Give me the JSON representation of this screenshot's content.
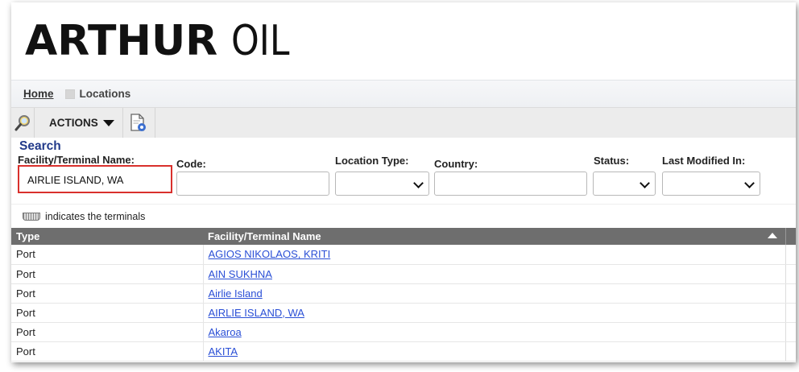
{
  "brand": {
    "name_bold": "ARTHUR",
    "name_thin": "OIL"
  },
  "breadcrumb": {
    "home": "Home",
    "current": "Locations"
  },
  "toolbar": {
    "actions_label": "ACTIONS"
  },
  "search": {
    "title": "Search",
    "facility_label": "Facility/Terminal Name:",
    "facility_value": "AIRLIE ISLAND, WA",
    "code_label": "Code:",
    "code_value": "",
    "location_type_label": "Location Type:",
    "location_type_value": "",
    "country_label": "Country:",
    "country_value": "",
    "status_label": "Status:",
    "status_value": "",
    "last_modified_label": "Last Modified In:",
    "last_modified_value": ""
  },
  "terminal_note": "indicates the terminals",
  "table": {
    "columns": [
      "Type",
      "Facility/Terminal Name"
    ],
    "rows": [
      {
        "type": "Port",
        "name": "AGIOS NIKOLAOS, KRITI"
      },
      {
        "type": "Port",
        "name": "AIN SUKHNA"
      },
      {
        "type": "Port",
        "name": "Airlie Island"
      },
      {
        "type": "Port",
        "name": "AIRLIE ISLAND, WA"
      },
      {
        "type": "Port",
        "name": "Akaroa"
      },
      {
        "type": "Port",
        "name": "AKITA"
      }
    ]
  },
  "colors": {
    "highlight": "#d9302c",
    "link": "#2a4fd6",
    "header_bg": "#6e6e6e",
    "search_title": "#223a8a"
  },
  "icons": [
    "search-magnifier-icon",
    "caret-down-icon",
    "document-settings-icon",
    "terminal-icon",
    "sort-ascending-icon",
    "chevron-down-icon"
  ]
}
